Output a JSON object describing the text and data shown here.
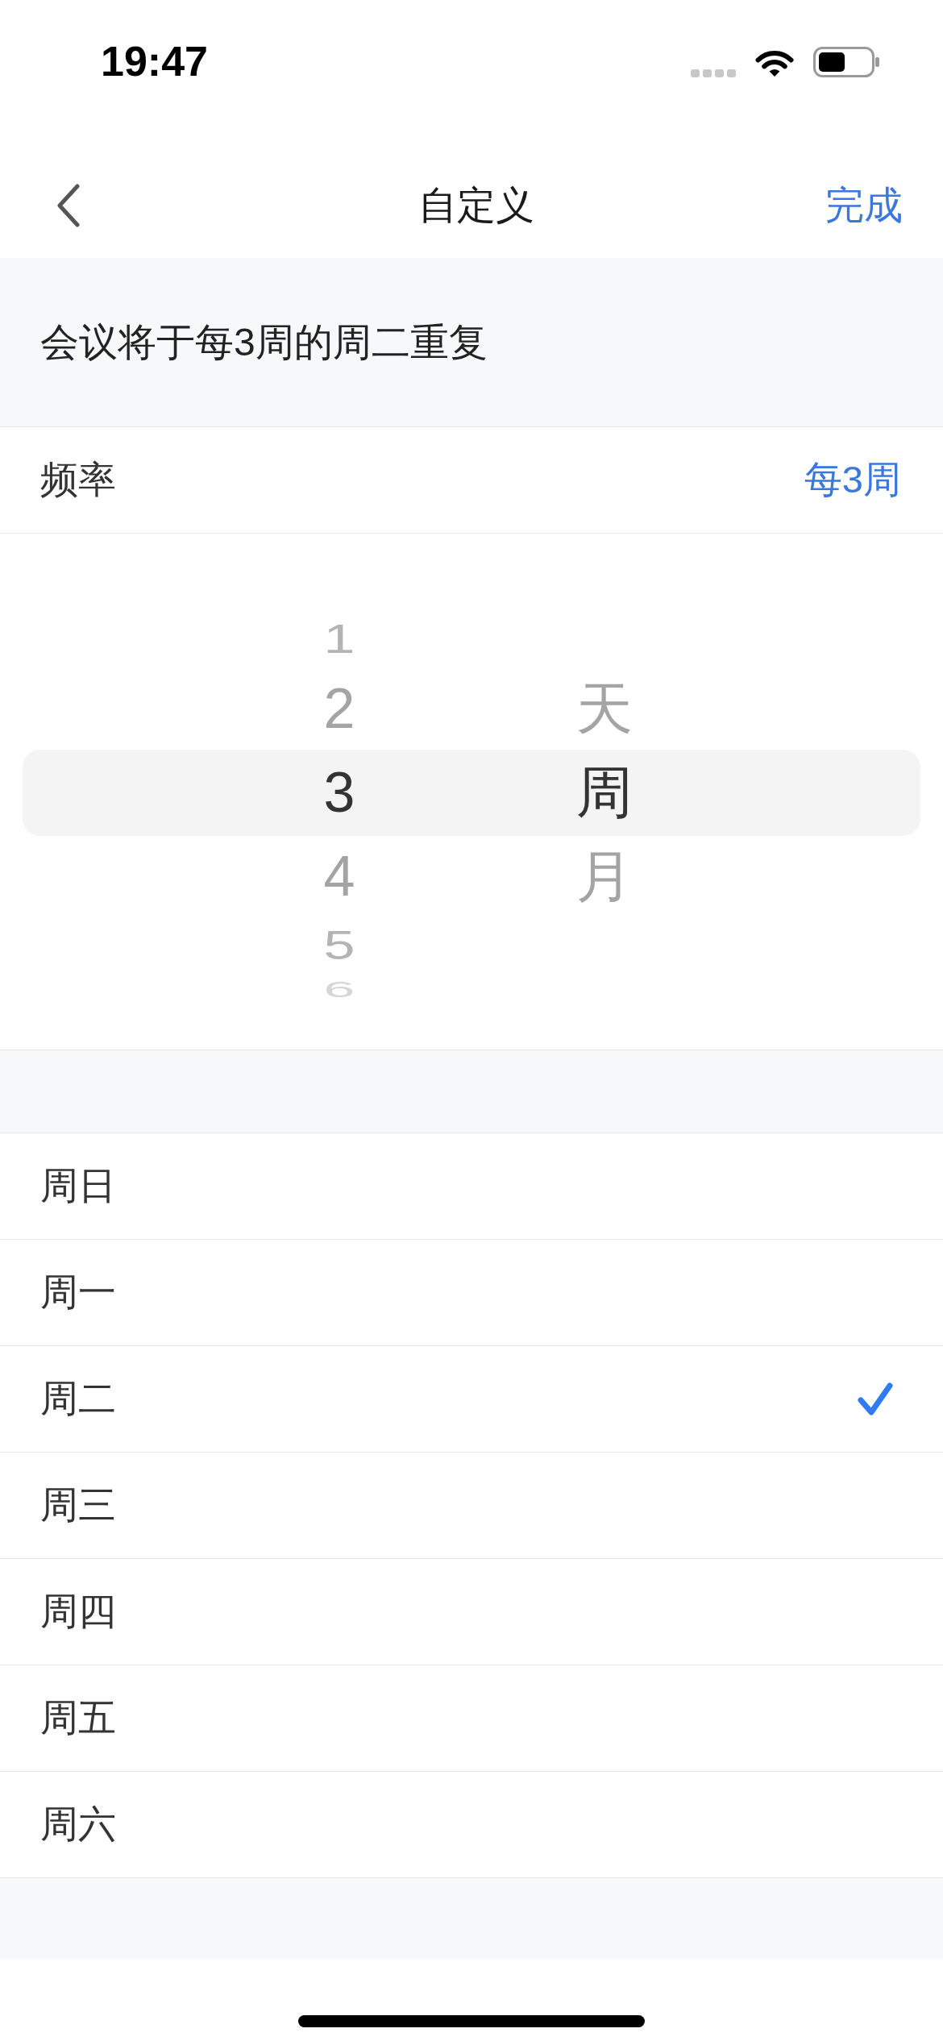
{
  "status_bar": {
    "time": "19:47"
  },
  "nav_bar": {
    "title": "自定义",
    "done_button": "完成"
  },
  "summary": "会议将于每3周的周二重复",
  "frequency": {
    "label": "频率",
    "value": "每3周"
  },
  "picker": {
    "columns": [
      {
        "items": [
          {
            "label": "1",
            "selected": false
          },
          {
            "label": "2",
            "selected": false
          },
          {
            "label": "3",
            "selected": true
          },
          {
            "label": "4",
            "selected": false
          },
          {
            "label": "5",
            "selected": false
          },
          {
            "label": "6",
            "selected": false
          }
        ]
      },
      {
        "items": [
          {
            "label": "天",
            "selected": false
          },
          {
            "label": "周",
            "selected": true
          },
          {
            "label": "月",
            "selected": false
          }
        ]
      }
    ]
  },
  "weekdays": [
    {
      "label": "周日",
      "selected": false
    },
    {
      "label": "周一",
      "selected": false
    },
    {
      "label": "周二",
      "selected": true
    },
    {
      "label": "周三",
      "selected": false
    },
    {
      "label": "周四",
      "selected": false
    },
    {
      "label": "周五",
      "selected": false
    },
    {
      "label": "周六",
      "selected": false
    }
  ]
}
